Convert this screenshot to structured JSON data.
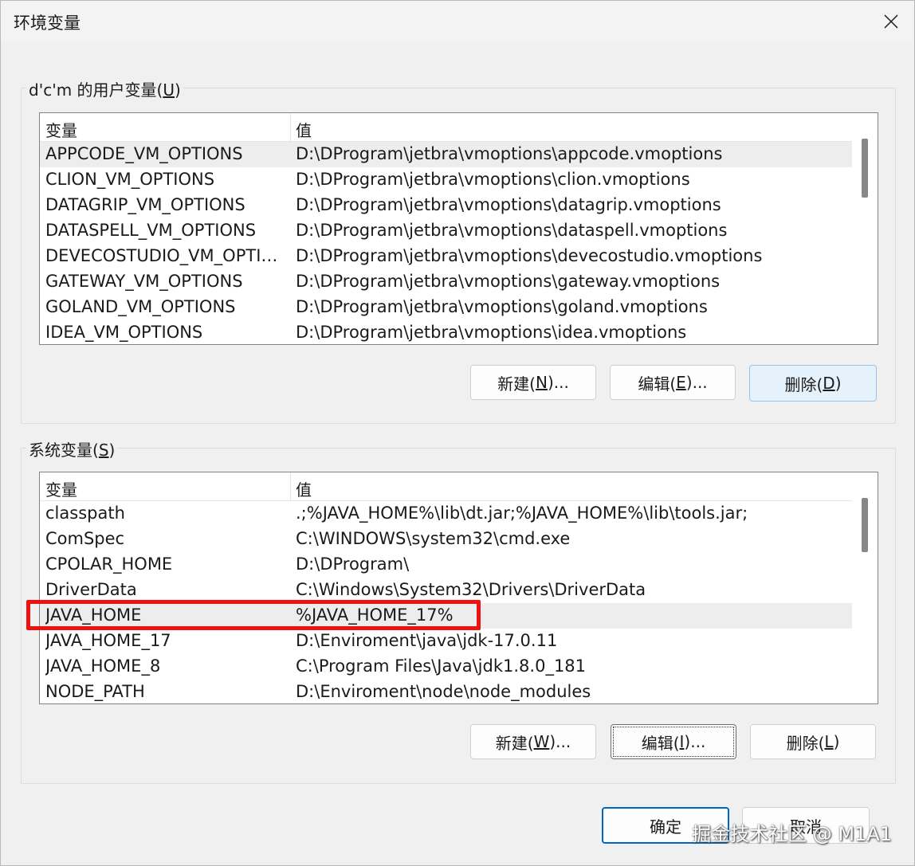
{
  "window": {
    "title": "环境变量"
  },
  "user_section": {
    "label_prefix": "d'c'm 的用户变量(",
    "label_key": "U",
    "label_suffix": ")",
    "columns": [
      "变量",
      "值"
    ],
    "rows": [
      {
        "name": "APPCODE_VM_OPTIONS",
        "value": "D:\\DProgram\\jetbra\\vmoptions\\appcode.vmoptions"
      },
      {
        "name": "CLION_VM_OPTIONS",
        "value": "D:\\DProgram\\jetbra\\vmoptions\\clion.vmoptions"
      },
      {
        "name": "DATAGRIP_VM_OPTIONS",
        "value": "D:\\DProgram\\jetbra\\vmoptions\\datagrip.vmoptions"
      },
      {
        "name": "DATASPELL_VM_OPTIONS",
        "value": "D:\\DProgram\\jetbra\\vmoptions\\dataspell.vmoptions"
      },
      {
        "name": "DEVECOSTUDIO_VM_OPTIO...",
        "value": "D:\\DProgram\\jetbra\\vmoptions\\devecostudio.vmoptions"
      },
      {
        "name": "GATEWAY_VM_OPTIONS",
        "value": "D:\\DProgram\\jetbra\\vmoptions\\gateway.vmoptions"
      },
      {
        "name": "GOLAND_VM_OPTIONS",
        "value": "D:\\DProgram\\jetbra\\vmoptions\\goland.vmoptions"
      },
      {
        "name": "IDEA_VM_OPTIONS",
        "value": "D:\\DProgram\\jetbra\\vmoptions\\idea.vmoptions"
      }
    ],
    "buttons": {
      "new": {
        "pre": "新建(",
        "key": "N",
        "post": ")..."
      },
      "edit": {
        "pre": "编辑(",
        "key": "E",
        "post": ")..."
      },
      "delete": {
        "pre": "删除(",
        "key": "D",
        "post": ")"
      }
    }
  },
  "system_section": {
    "label_prefix": "系统变量(",
    "label_key": "S",
    "label_suffix": ")",
    "columns": [
      "变量",
      "值"
    ],
    "rows": [
      {
        "name": "classpath",
        "value": ".;%JAVA_HOME%\\lib\\dt.jar;%JAVA_HOME%\\lib\\tools.jar;"
      },
      {
        "name": "ComSpec",
        "value": "C:\\WINDOWS\\system32\\cmd.exe"
      },
      {
        "name": "CPOLAR_HOME",
        "value": "D:\\DProgram\\"
      },
      {
        "name": "DriverData",
        "value": "C:\\Windows\\System32\\Drivers\\DriverData"
      },
      {
        "name": "JAVA_HOME",
        "value": "%JAVA_HOME_17%"
      },
      {
        "name": "JAVA_HOME_17",
        "value": "D:\\Enviroment\\java\\jdk-17.0.11"
      },
      {
        "name": "JAVA_HOME_8",
        "value": "C:\\Program Files\\Java\\jdk1.8.0_181"
      },
      {
        "name": "NODE_PATH",
        "value": "D:\\Enviroment\\node\\node_modules"
      }
    ],
    "buttons": {
      "new": {
        "pre": "新建(",
        "key": "W",
        "post": ")..."
      },
      "edit": {
        "pre": "编辑(",
        "key": "I",
        "post": ")..."
      },
      "delete": {
        "pre": "删除(",
        "key": "L",
        "post": ")"
      }
    }
  },
  "footer": {
    "ok_label": "确定",
    "cancel_label": "取消"
  },
  "watermark": "掘金技术社区 @ M1A1",
  "colors": {
    "highlight_box": "#ee1111",
    "default_button_border": "#0067c0"
  }
}
